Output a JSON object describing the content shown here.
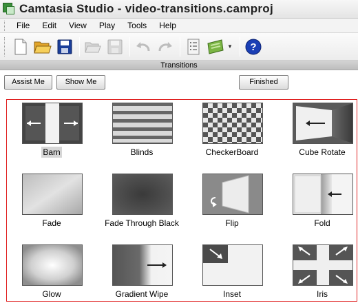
{
  "window": {
    "title": "Camtasia Studio - video-transitions.camproj"
  },
  "menu": [
    "File",
    "Edit",
    "View",
    "Play",
    "Tools",
    "Help"
  ],
  "toolbar": {
    "buttons": [
      "new-document",
      "open-folder",
      "save",
      "disabled-open",
      "disabled-save",
      "undo",
      "redo",
      "properties",
      "produce",
      "help"
    ]
  },
  "section": {
    "title": "Transitions"
  },
  "buttons": {
    "assist": "Assist Me",
    "show": "Show Me",
    "finished": "Finished"
  },
  "transitions": [
    {
      "label": "Barn",
      "selected": true
    },
    {
      "label": "Blinds"
    },
    {
      "label": "CheckerBoard"
    },
    {
      "label": "Cube Rotate"
    },
    {
      "label": "Fade"
    },
    {
      "label": "Fade Through Black"
    },
    {
      "label": "Flip"
    },
    {
      "label": "Fold"
    },
    {
      "label": "Glow"
    },
    {
      "label": "Gradient Wipe"
    },
    {
      "label": "Inset"
    },
    {
      "label": "Iris"
    }
  ],
  "colors": {
    "panel_border": "#e02020",
    "help_icon": "#1a3fb5",
    "save_icon": "#1b3f9a"
  }
}
